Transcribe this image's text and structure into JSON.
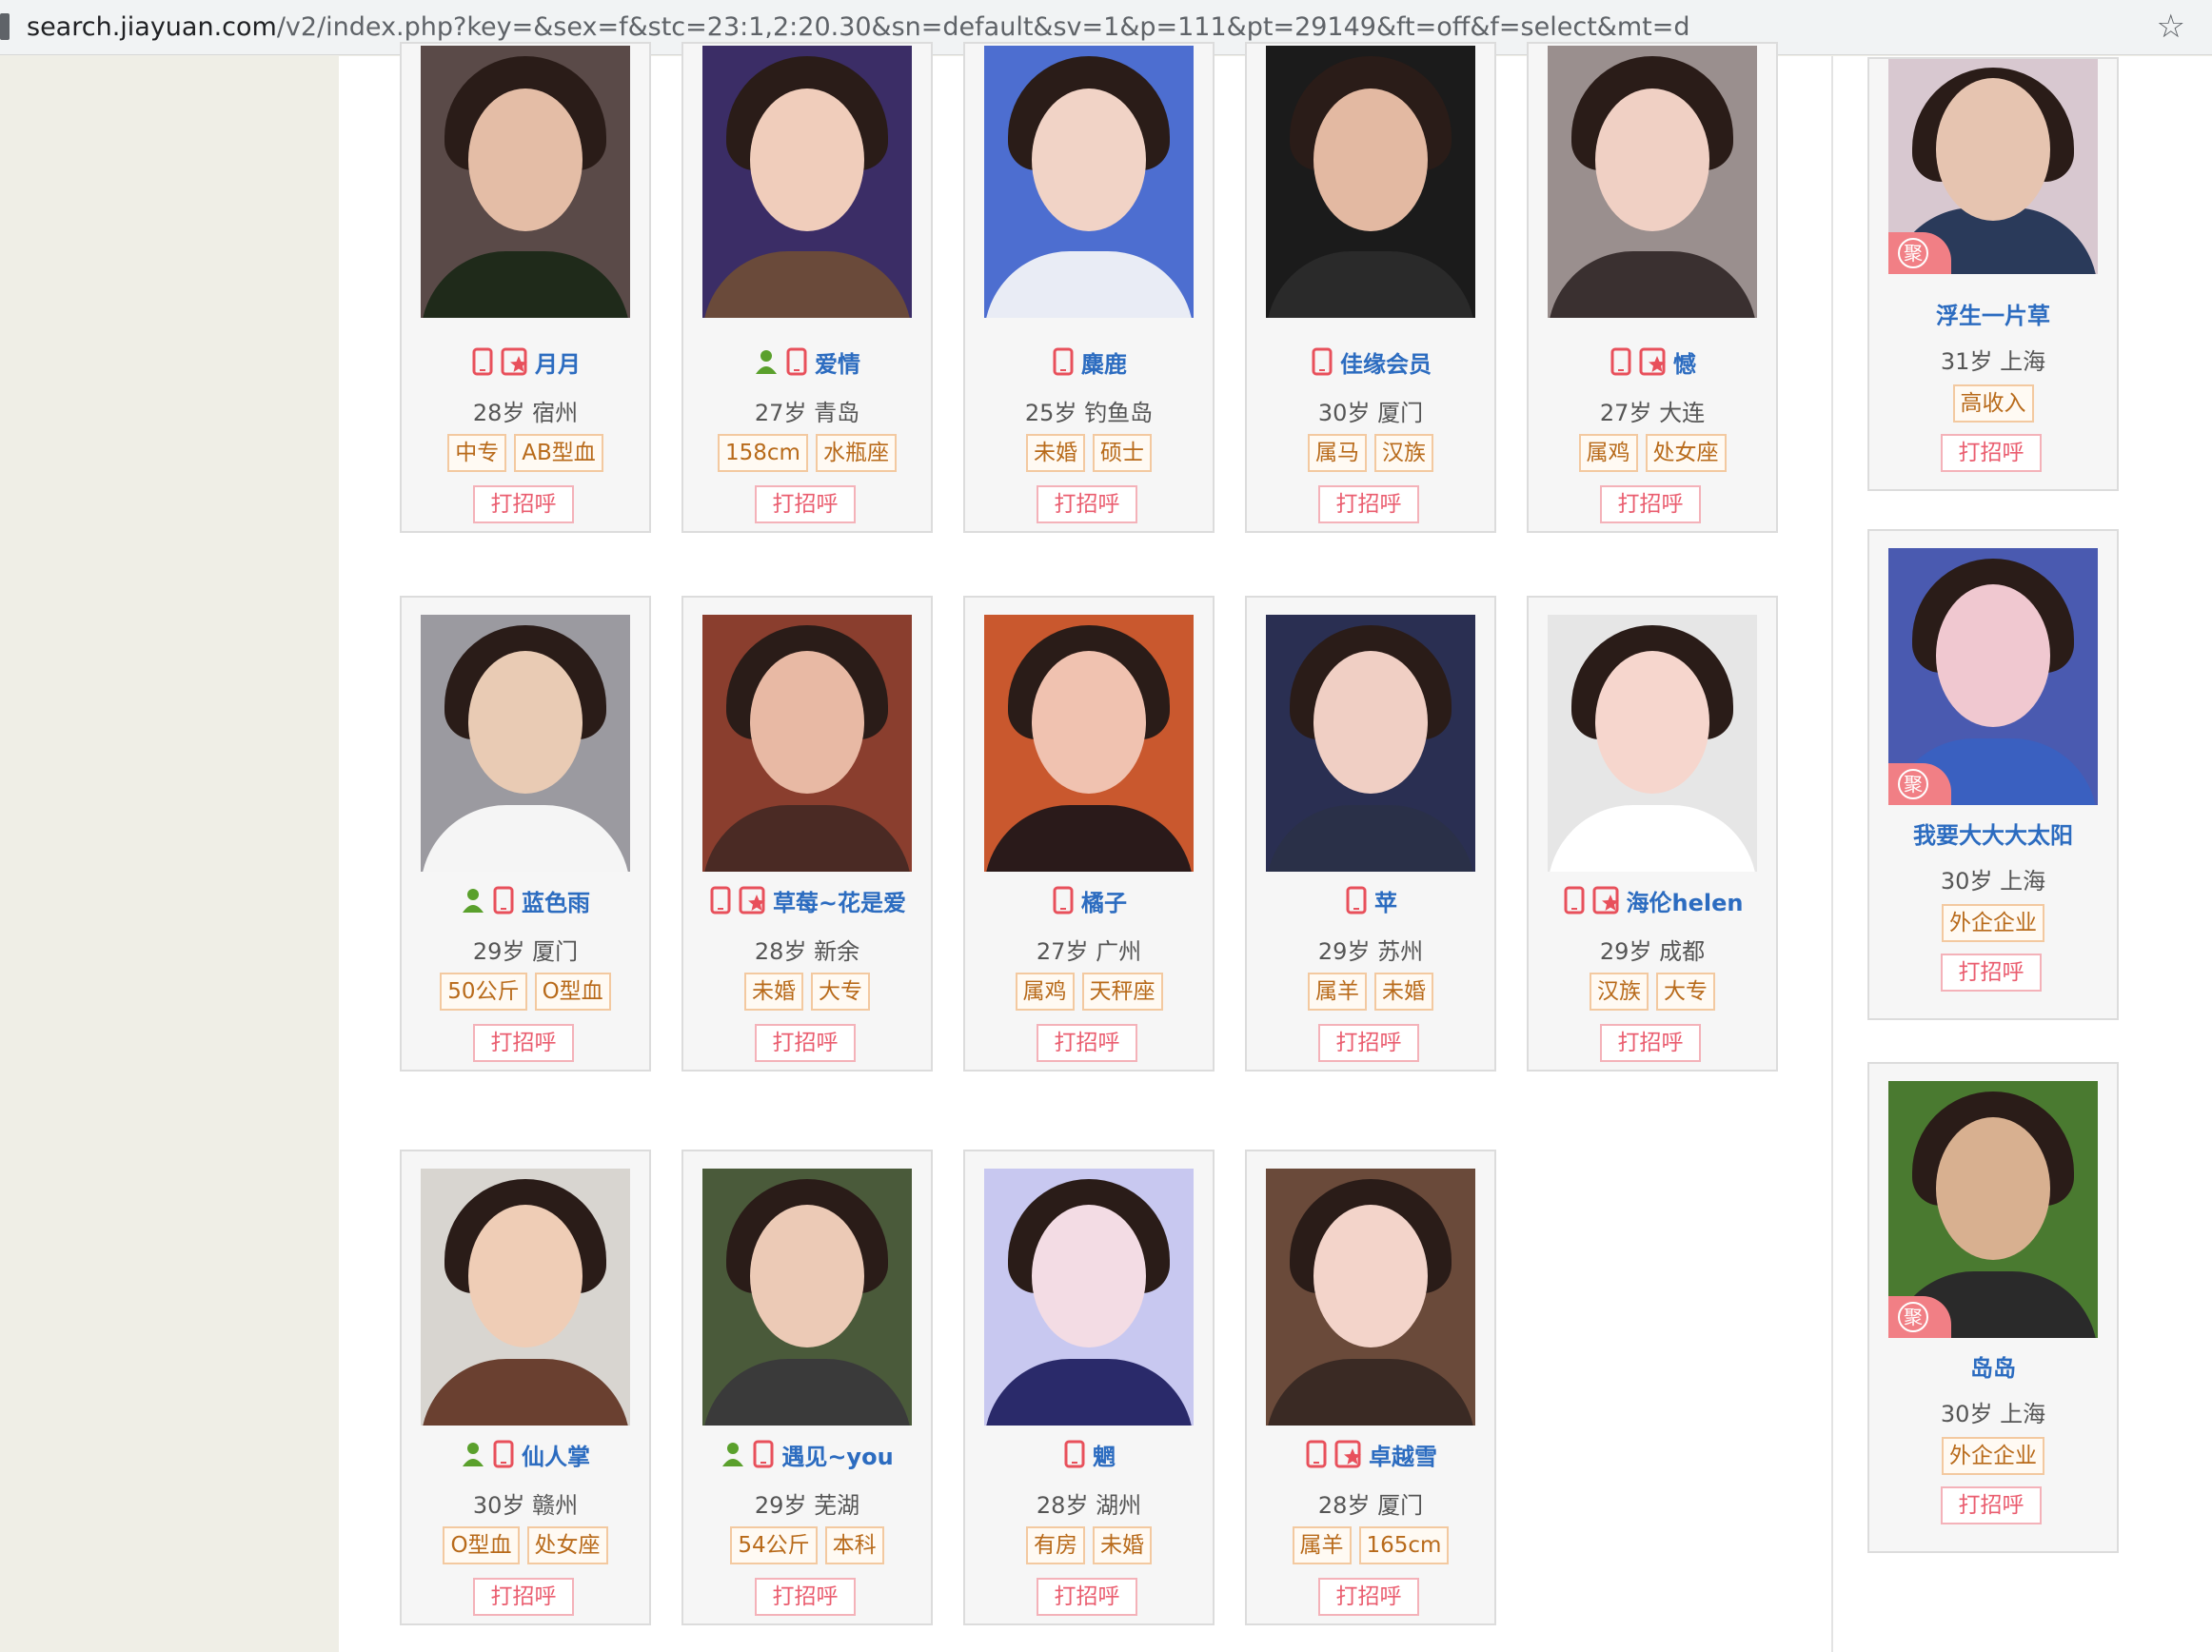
{
  "browser": {
    "url_host": "search.jiayuan.com",
    "url_path": "/v2/index.php?key=&sex=f&stc=23:1,2:20.30&sn=default&sv=1&p=111&pt=29149&ft=off&f=select&mt=d"
  },
  "colors": {
    "name_blue": "#2c6cc0",
    "tag_orange": "#b86a1a",
    "hi_red": "#ea5d6f",
    "phone_icon": "#e8505b",
    "vip_icon": "#e8505b",
    "verified_green": "#5aa02c"
  },
  "greet_label": "打招呼",
  "profiles": [
    {
      "name": "月月",
      "meta": "28岁 宿州",
      "tags": [
        "中专",
        "AB型血"
      ],
      "icons": [
        "phone",
        "vip"
      ]
    },
    {
      "name": "爱情",
      "meta": "27岁 青岛",
      "tags": [
        "158cm",
        "水瓶座"
      ],
      "icons": [
        "verified",
        "phone"
      ]
    },
    {
      "name": "麋鹿",
      "meta": "25岁 钓鱼岛",
      "tags": [
        "未婚",
        "硕士"
      ],
      "icons": [
        "phone"
      ]
    },
    {
      "name": "佳缘会员",
      "meta": "30岁 厦门",
      "tags": [
        "属马",
        "汉族"
      ],
      "icons": [
        "phone"
      ]
    },
    {
      "name": "憾",
      "meta": "27岁 大连",
      "tags": [
        "属鸡",
        "处女座"
      ],
      "icons": [
        "phone",
        "vip"
      ]
    },
    {
      "name": "蓝色雨",
      "meta": "29岁 厦门",
      "tags": [
        "50公斤",
        "O型血"
      ],
      "icons": [
        "verified",
        "phone"
      ]
    },
    {
      "name": "草莓~花是爱",
      "meta": "28岁 新余",
      "tags": [
        "未婚",
        "大专"
      ],
      "icons": [
        "phone",
        "vip"
      ]
    },
    {
      "name": "橘子",
      "meta": "27岁 广州",
      "tags": [
        "属鸡",
        "天秤座"
      ],
      "icons": [
        "phone"
      ]
    },
    {
      "name": "苹",
      "meta": "29岁 苏州",
      "tags": [
        "属羊",
        "未婚"
      ],
      "icons": [
        "phone"
      ]
    },
    {
      "name": "海伦helen",
      "meta": "29岁 成都",
      "tags": [
        "汉族",
        "大专"
      ],
      "icons": [
        "phone",
        "vip"
      ]
    },
    {
      "name": "仙人掌",
      "meta": "30岁 赣州",
      "tags": [
        "O型血",
        "处女座"
      ],
      "icons": [
        "verified",
        "phone"
      ]
    },
    {
      "name": "遇见~you",
      "meta": "29岁 芜湖",
      "tags": [
        "54公斤",
        "本科"
      ],
      "icons": [
        "verified",
        "phone"
      ]
    },
    {
      "name": "魍",
      "meta": "28岁 湖州",
      "tags": [
        "有房",
        "未婚"
      ],
      "icons": [
        "phone"
      ]
    },
    {
      "name": "卓越雪",
      "meta": "28岁 厦门",
      "tags": [
        "属羊",
        "165cm"
      ],
      "icons": [
        "phone",
        "vip"
      ]
    }
  ],
  "side_profiles": [
    {
      "name": "浮生一片草",
      "meta": "31岁 上海",
      "tag": "高收入",
      "badge": "聚"
    },
    {
      "name": "我要大大大太阳",
      "meta": "30岁 上海",
      "tag": "外企企业",
      "badge": "聚"
    },
    {
      "name": "岛岛",
      "meta": "30岁 上海",
      "tag": "外企企业",
      "badge": "聚"
    }
  ]
}
